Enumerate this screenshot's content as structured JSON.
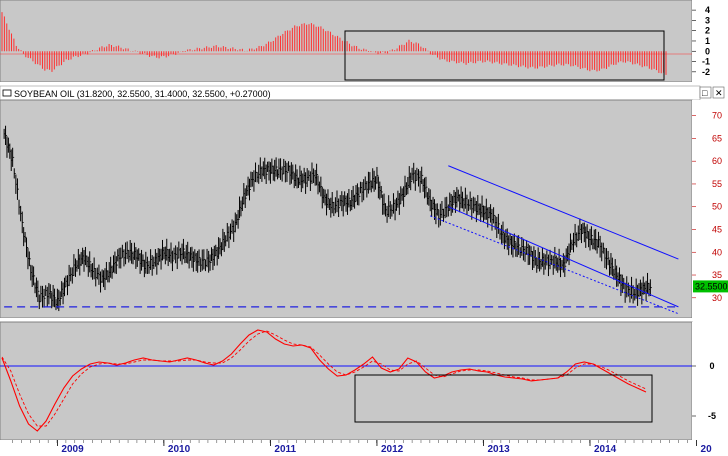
{
  "window": {
    "main_title": "SOYBEAN OIL (31.8200, 32.5500, 31.4000, 32.5500, +0.27000)",
    "button_maximize": "□",
    "button_close": "✕"
  },
  "colors": {
    "panel_bg": "#c8c8c8",
    "axis_bg": "#ffffff",
    "price_bar": "#000000",
    "histogram": "#ff3030",
    "trend_line": "#1010ff",
    "support_line": "#2020e0",
    "oscillator_line": "#ff0000",
    "axis_text_red": "#c00000",
    "price_marker_bg": "#00c000"
  },
  "chart_data": [
    {
      "type": "bar",
      "panel": "histogram",
      "y_ticks": [
        "4",
        "3",
        "2",
        "1",
        "0",
        "-1",
        "-2"
      ],
      "ylim": [
        -2.6,
        4.4
      ],
      "series": [
        {
          "values": [
            3.8,
            2.2,
            0.6,
            -0.3,
            -0.8,
            -1.3,
            -1.8,
            -1.9,
            -1.4,
            -0.9,
            -0.6,
            -0.4,
            -0.2,
            0.1,
            0.4,
            0.6,
            0.5,
            0.3,
            0.1,
            -0.1,
            -0.3,
            -0.5,
            -0.6,
            -0.5,
            -0.3,
            -0.1,
            0.1,
            0.2,
            0.3,
            0.4,
            0.5,
            0.4,
            0.3,
            0.2,
            0.1,
            0.2,
            0.4,
            0.7,
            1.1,
            1.6,
            2.0,
            2.4,
            2.6,
            2.7,
            2.5,
            2.2,
            1.8,
            1.4,
            1.0,
            0.6,
            0.3,
            0.1,
            -0.1,
            -0.2,
            -0.1,
            0.2,
            0.6,
            1.0,
            0.8,
            0.4,
            -0.2,
            -0.6,
            -0.9,
            -1.0,
            -1.1,
            -1.2,
            -1.1,
            -1.0,
            -1.0,
            -1.1,
            -1.2,
            -1.3,
            -1.4,
            -1.5,
            -1.6,
            -1.6,
            -1.5,
            -1.4,
            -1.3,
            -1.3,
            -1.4,
            -1.6,
            -1.8,
            -1.9,
            -1.8,
            -1.5,
            -1.2,
            -1.0,
            -1.1,
            -1.3,
            -1.5,
            -1.7,
            -2.0,
            -2.3
          ]
        }
      ]
    },
    {
      "type": "line",
      "panel": "price",
      "title": "SOYBEAN OIL (31.8200, 32.5500, 31.4000, 32.5500, +0.27000)",
      "last_price_label": "32.5500",
      "y_ticks": [
        "70",
        "65",
        "60",
        "55",
        "50",
        "45",
        "40",
        "35",
        "30"
      ],
      "ylim": [
        26,
        73
      ],
      "x": [
        2008.5,
        2008.58,
        2008.67,
        2008.75,
        2008.83,
        2008.92,
        2009.0,
        2009.08,
        2009.17,
        2009.25,
        2009.33,
        2009.42,
        2009.5,
        2009.58,
        2009.67,
        2009.75,
        2009.83,
        2009.92,
        2010.0,
        2010.08,
        2010.17,
        2010.25,
        2010.33,
        2010.42,
        2010.5,
        2010.58,
        2010.67,
        2010.75,
        2010.83,
        2010.92,
        2011.0,
        2011.08,
        2011.17,
        2011.25,
        2011.33,
        2011.42,
        2011.5,
        2011.58,
        2011.67,
        2011.75,
        2011.83,
        2011.92,
        2012.0,
        2012.08,
        2012.17,
        2012.25,
        2012.33,
        2012.42,
        2012.5,
        2012.58,
        2012.67,
        2012.75,
        2012.83,
        2012.92,
        2013.0,
        2013.08,
        2013.17,
        2013.25,
        2013.33,
        2013.42,
        2013.5,
        2013.58,
        2013.67,
        2013.75,
        2013.83,
        2013.92,
        2014.0,
        2014.08,
        2014.17,
        2014.25,
        2014.33,
        2014.42,
        2014.5,
        2014.58
      ],
      "series": [
        {
          "values": [
            66,
            60,
            46,
            36,
            30,
            31,
            29,
            33,
            37,
            39,
            36,
            34,
            36,
            39,
            40,
            39,
            37,
            38,
            40,
            39,
            40,
            39,
            38,
            38,
            40,
            43,
            46,
            52,
            56,
            58,
            58,
            58,
            58,
            56,
            56,
            57,
            52,
            50,
            51,
            51,
            53,
            55,
            56,
            49,
            50,
            53,
            57,
            56,
            51,
            48,
            50,
            52,
            51,
            50,
            49,
            48,
            44,
            42,
            41,
            40,
            38,
            38,
            38,
            37,
            42,
            45,
            43,
            42,
            38,
            35,
            32,
            31,
            32,
            32.5
          ]
        }
      ],
      "trendlines": [
        {
          "x": [
            2012.67,
            2014.83
          ],
          "y": [
            59,
            38.5
          ]
        },
        {
          "x": [
            2012.67,
            2014.83
          ],
          "y": [
            50,
            28
          ]
        },
        {
          "x": [
            2012.5,
            2014.83
          ],
          "y": [
            48,
            26.5
          ]
        },
        {
          "x": [
            2008.5,
            2014.83
          ],
          "y": [
            28,
            28
          ]
        }
      ]
    },
    {
      "type": "line",
      "panel": "oscillator",
      "y_ticks": [
        "0",
        "-5"
      ],
      "ylim": [
        -7,
        4
      ],
      "x_ticks": [
        "2009",
        "2010",
        "2011",
        "2012",
        "2013",
        "2014",
        "20"
      ],
      "series": [
        {
          "values": [
            0.8,
            -1.5,
            -4.0,
            -5.8,
            -6.5,
            -5.5,
            -3.8,
            -2.2,
            -1.0,
            -0.3,
            0.2,
            0.4,
            0.3,
            0.1,
            0.3,
            0.6,
            0.8,
            0.6,
            0.5,
            0.4,
            0.6,
            0.8,
            0.6,
            0.3,
            0.1,
            0.5,
            1.2,
            2.2,
            3.1,
            3.6,
            3.4,
            2.7,
            2.2,
            2.0,
            2.1,
            1.8,
            0.6,
            -0.3,
            -1.0,
            -0.9,
            -0.4,
            0.2,
            0.9,
            -0.2,
            -0.6,
            -0.3,
            0.8,
            0.4,
            -0.6,
            -1.2,
            -1.0,
            -0.6,
            -0.4,
            -0.3,
            -0.5,
            -0.6,
            -0.9,
            -1.1,
            -1.2,
            -1.3,
            -1.5,
            -1.4,
            -1.3,
            -1.2,
            -0.6,
            0.2,
            0.4,
            0.2,
            -0.3,
            -0.8,
            -1.3,
            -1.8,
            -2.2,
            -2.6
          ]
        },
        {
          "values": [
            0.9,
            -0.5,
            -2.8,
            -4.8,
            -6.0,
            -6.0,
            -4.8,
            -3.3,
            -1.8,
            -0.8,
            -0.1,
            0.2,
            0.3,
            0.2,
            0.2,
            0.4,
            0.6,
            0.6,
            0.5,
            0.5,
            0.5,
            0.6,
            0.6,
            0.4,
            0.3,
            0.3,
            0.8,
            1.6,
            2.5,
            3.2,
            3.5,
            3.1,
            2.6,
            2.2,
            2.1,
            1.9,
            1.1,
            0.2,
            -0.6,
            -0.9,
            -0.6,
            -0.1,
            0.5,
            0.2,
            -0.4,
            -0.5,
            0.2,
            0.5,
            -0.2,
            -0.9,
            -1.1,
            -0.8,
            -0.5,
            -0.4,
            -0.4,
            -0.5,
            -0.7,
            -0.9,
            -1.1,
            -1.2,
            -1.4,
            -1.4,
            -1.3,
            -1.2,
            -0.9,
            -0.2,
            0.2,
            0.2,
            -0.1,
            -0.5,
            -1.0,
            -1.5,
            -1.9,
            -2.3
          ]
        }
      ]
    }
  ]
}
